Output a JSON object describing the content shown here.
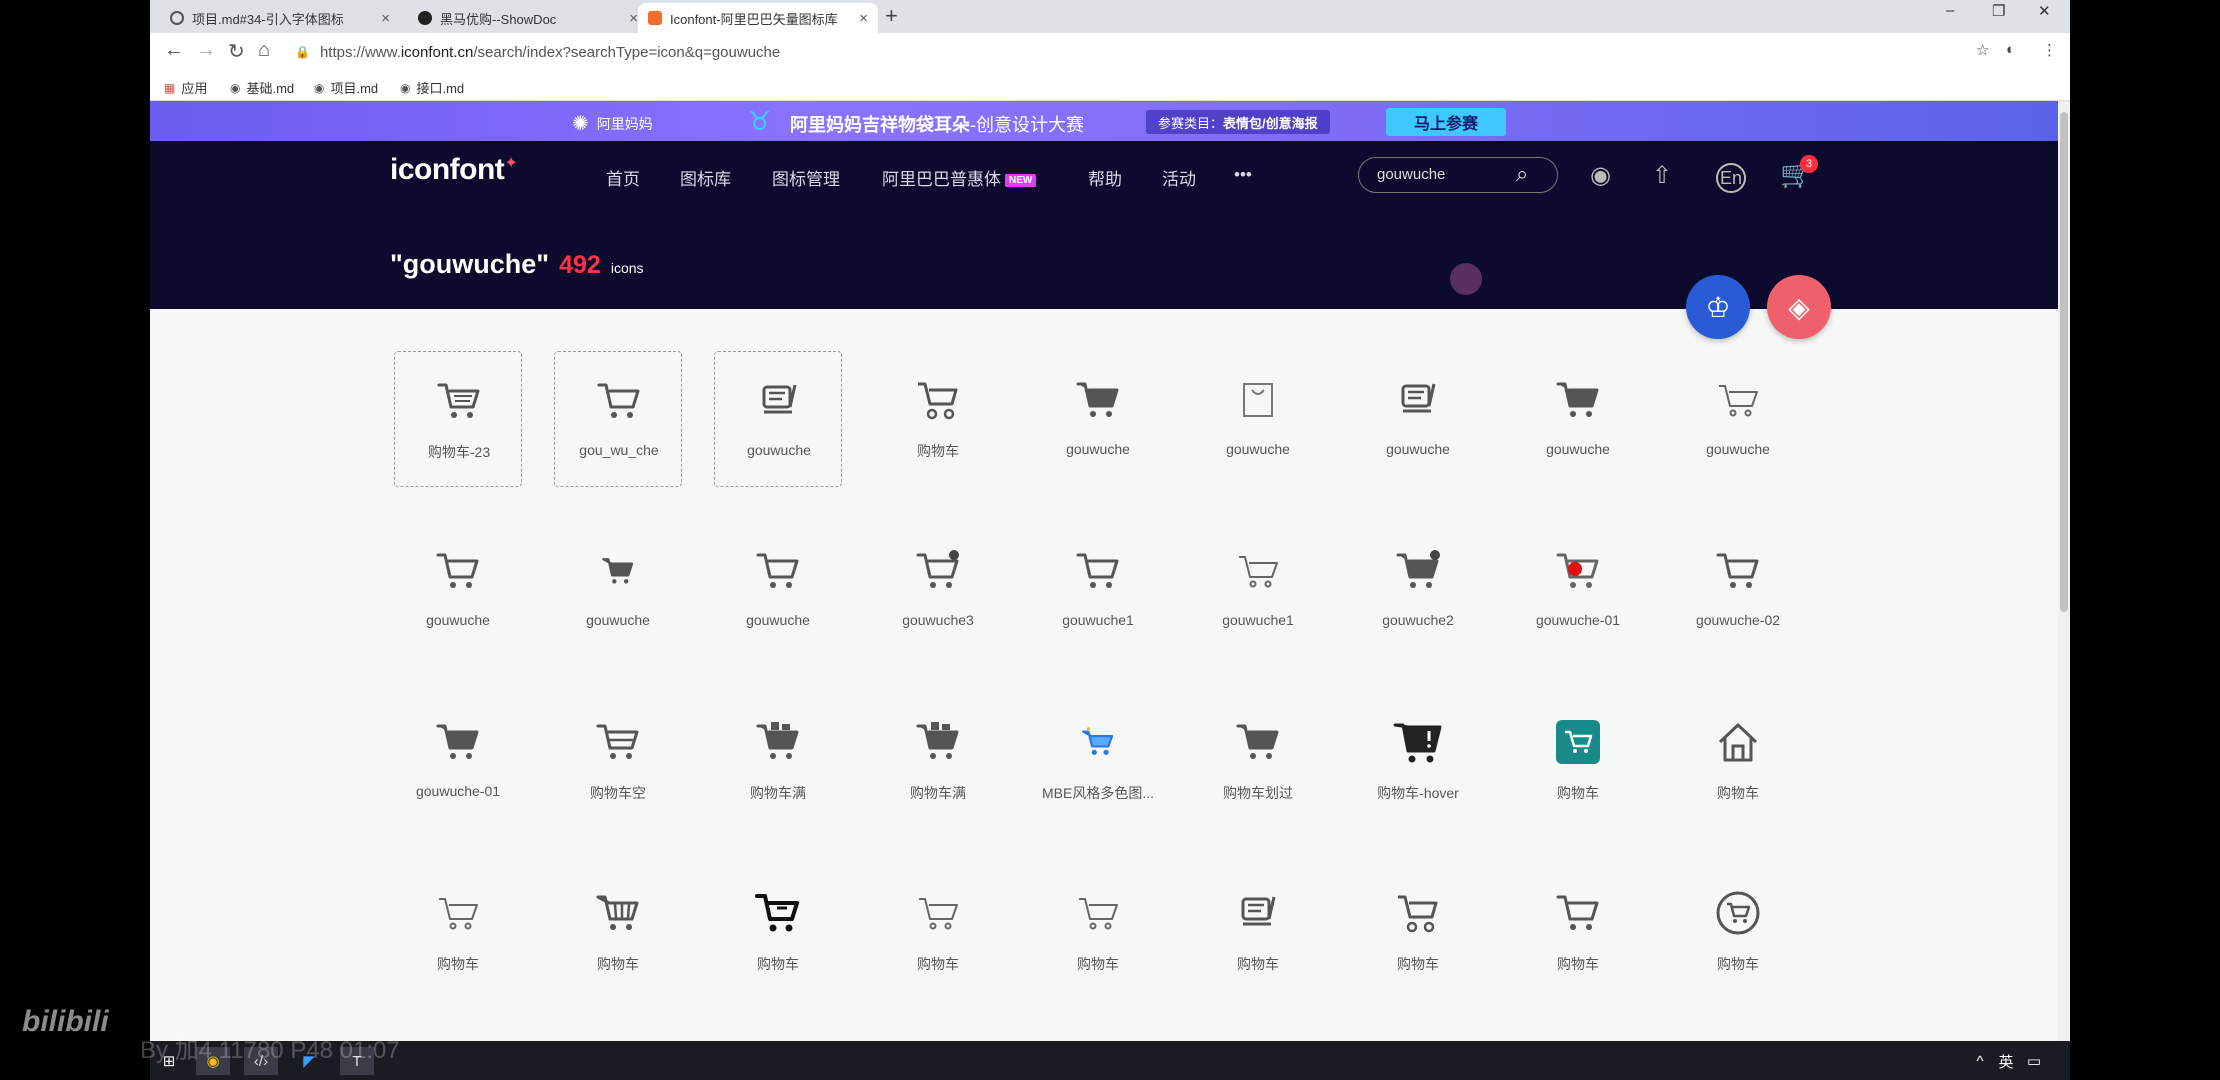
{
  "tabs": [
    {
      "title": "项目.md#34-引入字体图标",
      "close": "×"
    },
    {
      "title": "黑马优购--ShowDoc",
      "close": "×"
    },
    {
      "title": "Iconfont-阿里巴巴矢量图标库",
      "close": "×"
    }
  ],
  "new_tab": "+",
  "window_controls": {
    "minimize": "–",
    "restore": "❐",
    "close": "✕"
  },
  "address": {
    "prefix": "https://www.",
    "host": "iconfont.cn",
    "path": "/search/index?searchType=icon&q=gouwuche"
  },
  "bookmarks": [
    "应用",
    "基础.md",
    "项目.md",
    "接口.md"
  ],
  "promo": {
    "logo": "阿里妈妈",
    "title": "阿里妈妈吉祥物袋耳朵",
    "title_suffix": "-创意设计大赛",
    "category_label": "参赛类目：",
    "category_value": "表情包/创意海报",
    "cta": "马上参赛"
  },
  "brand": {
    "name": "iconfont",
    "mark": "✦"
  },
  "nav": [
    "首页",
    "图标库",
    "图标管理",
    "阿里巴巴普惠体",
    "帮助",
    "活动",
    "•••"
  ],
  "nav_new_badge": "NEW",
  "search_value": "gouwuche",
  "cart_count": "3",
  "lang_label": "En",
  "result": {
    "query": "\"gouwuche\"",
    "count": "492",
    "unit": "icons"
  },
  "icons": [
    {
      "label": "购物车-23",
      "icon": "cart-list-icon",
      "selected": true
    },
    {
      "label": "gou_wu_che",
      "icon": "cart-outline-icon",
      "selected": true
    },
    {
      "label": "gouwuche",
      "icon": "cart-lines-icon",
      "selected": true
    },
    {
      "label": "购物车",
      "icon": "cart-wheels-icon"
    },
    {
      "label": "gouwuche",
      "icon": "cart-filled-icon"
    },
    {
      "label": "gouwuche",
      "icon": "bag-icon"
    },
    {
      "label": "gouwuche",
      "icon": "cart-lines-icon"
    },
    {
      "label": "gouwuche",
      "icon": "cart-filled-icon"
    },
    {
      "label": "gouwuche",
      "icon": "cart-thin-icon"
    },
    {
      "label": "gouwuche",
      "icon": "cart-outline-icon"
    },
    {
      "label": "gouwuche",
      "icon": "cart-small-filled-icon"
    },
    {
      "label": "gouwuche",
      "icon": "cart-outline-icon"
    },
    {
      "label": "gouwuche3",
      "icon": "cart-dot-icon"
    },
    {
      "label": "gouwuche1",
      "icon": "cart-outline-icon"
    },
    {
      "label": "gouwuche1",
      "icon": "cart-thin-icon"
    },
    {
      "label": "gouwuche2",
      "icon": "cart-filled-dot-icon"
    },
    {
      "label": "gouwuche-01",
      "icon": "cart-red-dot-icon"
    },
    {
      "label": "gouwuche-02",
      "icon": "cart-outline-icon"
    },
    {
      "label": "gouwuche-01",
      "icon": "cart-filled-icon"
    },
    {
      "label": "购物车空",
      "icon": "cart-empty-icon"
    },
    {
      "label": "购物车满",
      "icon": "cart-full-icon"
    },
    {
      "label": "购物车满",
      "icon": "cart-full-icon"
    },
    {
      "label": "MBE风格多色图...",
      "icon": "cart-blue-icon"
    },
    {
      "label": "购物车划过",
      "icon": "cart-filled-icon"
    },
    {
      "label": "购物车-hover",
      "icon": "cart-alert-icon"
    },
    {
      "label": "购物车",
      "icon": "cart-teal-badge-icon"
    },
    {
      "label": "购物车",
      "icon": "house-icon"
    },
    {
      "label": "购物车",
      "icon": "cart-thin-icon"
    },
    {
      "label": "购物车",
      "icon": "basket-icon"
    },
    {
      "label": "购物车",
      "icon": "cart-bold-icon"
    },
    {
      "label": "购物车",
      "icon": "cart-thin-icon"
    },
    {
      "label": "购物车",
      "icon": "cart-thin-icon"
    },
    {
      "label": "购物车",
      "icon": "cart-lines-icon"
    },
    {
      "label": "购物车",
      "icon": "cart-wheels-icon"
    },
    {
      "label": "购物车",
      "icon": "cart-outline-icon"
    },
    {
      "label": "购物车",
      "icon": "cart-circle-icon"
    }
  ],
  "colors": {
    "header_bg": "#0c0b2e",
    "accent_red": "#ff3344",
    "crown_fab": "#2a5bd7",
    "paint_fab": "#f0606c",
    "icon_gray": "#555555"
  },
  "fabs": {
    "crown": "crown-icon",
    "paint": "paint-bucket-icon"
  },
  "taskbar_right": {
    "ime": "英"
  },
  "watermark": {
    "logo": "bilibili",
    "by": "By 加4 11780 P48 01:07"
  }
}
